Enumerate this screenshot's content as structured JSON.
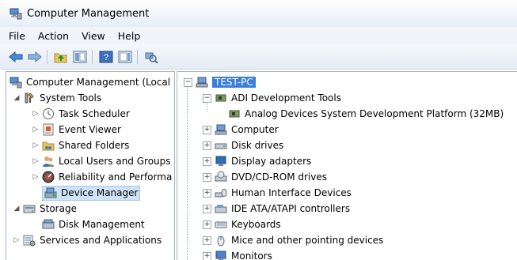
{
  "window": {
    "title": "Computer Management"
  },
  "menu": {
    "items": [
      "File",
      "Action",
      "View",
      "Help"
    ]
  },
  "left_tree": {
    "root": "Computer Management (Local",
    "system_tools": "System Tools",
    "task_scheduler": "Task Scheduler",
    "event_viewer": "Event Viewer",
    "shared_folders": "Shared Folders",
    "local_users": "Local Users and Groups",
    "reliability": "Reliability and Performa",
    "device_manager": "Device Manager",
    "storage": "Storage",
    "disk_management": "Disk Management",
    "services": "Services and Applications"
  },
  "right_tree": {
    "root": "TEST-PC",
    "adi": "ADI Development Tools",
    "adi_child": "Analog Devices System Development Platform (32MB)",
    "categories": [
      "Computer",
      "Disk drives",
      "Display adapters",
      "DVD/CD-ROM drives",
      "Human Interface Devices",
      "IDE ATA/ATAPI controllers",
      "Keyboards",
      "Mice and other pointing devices",
      "Monitors"
    ]
  }
}
